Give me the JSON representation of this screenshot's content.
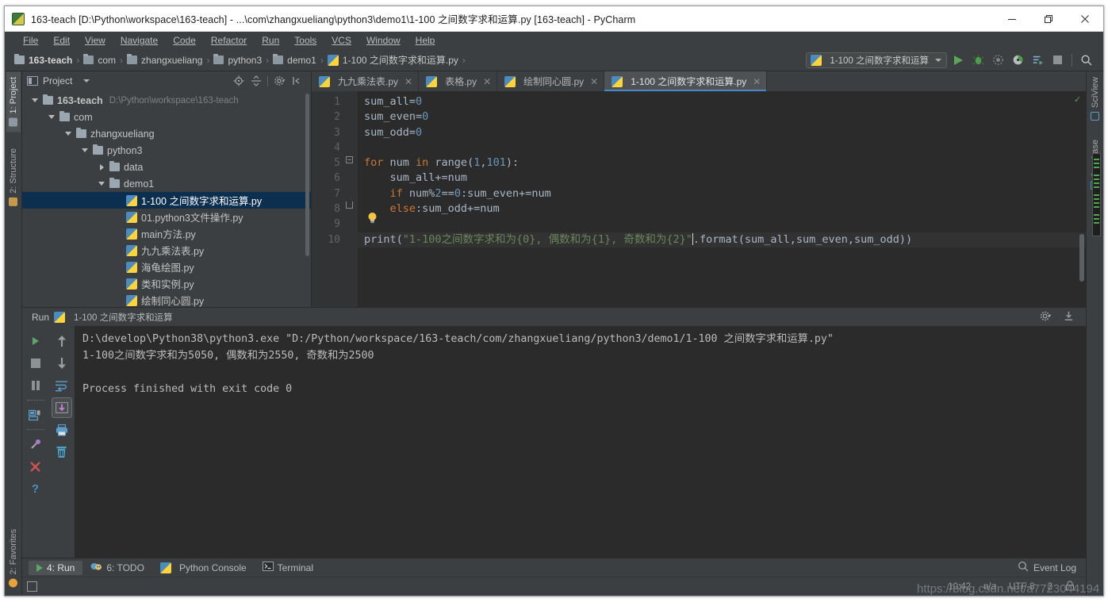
{
  "window": {
    "title": "163-teach [D:\\Python\\workspace\\163-teach] - ...\\com\\zhangxueliang\\python3\\demo1\\1-100 之间数字求和运算.py [163-teach] - PyCharm",
    "icon": "pycharm-icon",
    "minimize": "—",
    "maximize": "❐",
    "close": "✕"
  },
  "menubar": [
    {
      "label": "File"
    },
    {
      "label": "Edit"
    },
    {
      "label": "View"
    },
    {
      "label": "Navigate"
    },
    {
      "label": "Code"
    },
    {
      "label": "Refactor"
    },
    {
      "label": "Run"
    },
    {
      "label": "Tools"
    },
    {
      "label": "VCS"
    },
    {
      "label": "Window"
    },
    {
      "label": "Help"
    }
  ],
  "breadcrumb": [
    {
      "label": "163-teach",
      "icon": "folder-icon"
    },
    {
      "label": "com",
      "icon": "folder-icon"
    },
    {
      "label": "zhangxueliang",
      "icon": "folder-icon"
    },
    {
      "label": "python3",
      "icon": "folder-icon"
    },
    {
      "label": "demo1",
      "icon": "folder-icon"
    },
    {
      "label": "1-100 之间数字求和运算.py",
      "icon": "python-file-icon"
    }
  ],
  "toolbar": {
    "run_config": "1-100 之间数字求和运算",
    "buttons": [
      "run-button",
      "debug-button",
      "coverage-button",
      "profile-button",
      "rerun-button",
      "stop-button",
      "search-everywhere-button"
    ]
  },
  "left_strip": [
    {
      "label": "1: Project",
      "active": true
    },
    {
      "label": "2: Structure",
      "active": false
    },
    {
      "label": "2: Favorites",
      "active": false
    }
  ],
  "right_strip": [
    {
      "label": "SciView"
    },
    {
      "label": "Database"
    }
  ],
  "project": {
    "title": "Project",
    "tree": [
      {
        "indent": 0,
        "arrow": "down",
        "icon": "folder-icon",
        "label": "163-teach",
        "path": "D:\\Python\\workspace\\163-teach",
        "bold": true,
        "selected": false
      },
      {
        "indent": 1,
        "arrow": "down",
        "icon": "folder-icon",
        "label": "com",
        "path": "",
        "bold": false,
        "selected": false
      },
      {
        "indent": 2,
        "arrow": "down",
        "icon": "folder-icon",
        "label": "zhangxueliang",
        "path": "",
        "bold": false,
        "selected": false
      },
      {
        "indent": 3,
        "arrow": "down",
        "icon": "folder-icon",
        "label": "python3",
        "path": "",
        "bold": false,
        "selected": false
      },
      {
        "indent": 4,
        "arrow": "right",
        "icon": "folder-icon",
        "label": "data",
        "path": "",
        "bold": false,
        "selected": false
      },
      {
        "indent": 4,
        "arrow": "down",
        "icon": "folder-icon",
        "label": "demo1",
        "path": "",
        "bold": false,
        "selected": false
      },
      {
        "indent": 5,
        "arrow": "none",
        "icon": "python-file-icon",
        "label": "1-100 之间数字求和运算.py",
        "path": "",
        "bold": false,
        "selected": true
      },
      {
        "indent": 5,
        "arrow": "none",
        "icon": "python-file-icon",
        "label": "01.python3文件操作.py",
        "path": "",
        "bold": false,
        "selected": false
      },
      {
        "indent": 5,
        "arrow": "none",
        "icon": "python-file-icon",
        "label": "main方法.py",
        "path": "",
        "bold": false,
        "selected": false
      },
      {
        "indent": 5,
        "arrow": "none",
        "icon": "python-file-icon",
        "label": "九九乘法表.py",
        "path": "",
        "bold": false,
        "selected": false
      },
      {
        "indent": 5,
        "arrow": "none",
        "icon": "python-file-icon",
        "label": "海龟绘图.py",
        "path": "",
        "bold": false,
        "selected": false
      },
      {
        "indent": 5,
        "arrow": "none",
        "icon": "python-file-icon",
        "label": "类和实例.py",
        "path": "",
        "bold": false,
        "selected": false
      },
      {
        "indent": 5,
        "arrow": "none",
        "icon": "python-file-icon",
        "label": "绘制同心圆.py",
        "path": "",
        "bold": false,
        "selected": false
      }
    ]
  },
  "editor": {
    "tabs": [
      {
        "label": "九九乘法表.py",
        "active": false
      },
      {
        "label": "表格.py",
        "active": false
      },
      {
        "label": "绘制同心圆.py",
        "active": false
      },
      {
        "label": "1-100 之间数字求和运算.py",
        "active": true
      }
    ],
    "line_numbers": [
      "1",
      "2",
      "3",
      "4",
      "5",
      "6",
      "7",
      "8",
      "9",
      "10"
    ],
    "code": {
      "l1_var": "sum_all",
      "l1_eq": "=",
      "l1_num": "0",
      "l2_var": "sum_even",
      "l2_num": "0",
      "l3_var": "sum_odd",
      "l3_num": "0",
      "l5_kw_for": "for",
      "l5_var": " num ",
      "l5_kw_in": "in",
      "l5_fn": " range(",
      "l5_a": "1",
      "l5_comma": ",",
      "l5_b": "101",
      "l5_end": "):",
      "l6": "    sum_all+=num",
      "l7_pre": "    ",
      "l7_kw": "if",
      "l7_mid": " num%",
      "l7_n2": "2",
      "l7_eq": "==",
      "l7_n0": "0",
      "l7_rest": ":sum_even+=num",
      "l8_pre": "    ",
      "l8_kw": "else",
      "l8_rest": ":sum_odd+=num",
      "l10_fn": "print",
      "l10_open": "(",
      "l10_str": "\"1-100之间数字求和为{0}, 偶数和为{1}, 奇数和为{2}\"",
      "l10_tail": ".format(sum_all,sum_even,sum_odd))"
    }
  },
  "run_panel": {
    "title": "Run",
    "config_name": "1-100 之间数字求和运算",
    "output": [
      "D:\\develop\\Python38\\python3.exe \"D:/Python/workspace/163-teach/com/zhangxueliang/python3/demo1/1-100 之间数字求和运算.py\"",
      "1-100之间数字求和为5050, 偶数和为2550, 奇数和为2500",
      "",
      "Process finished with exit code 0"
    ],
    "left_tools": [
      "rerun-icon",
      "stop-icon",
      "pause-icon",
      "print-settings-icon",
      "pin-icon",
      "close-icon",
      "help-icon"
    ],
    "right_tools": [
      "scroll-up-icon",
      "scroll-down-icon",
      "soft-wrap-icon",
      "scroll-to-end-icon",
      "print-icon",
      "trash-icon"
    ],
    "header_tools": [
      "settings-icon",
      "hide-icon"
    ]
  },
  "statusbar": {
    "tabs": [
      {
        "label": "4: Run",
        "icon": "run-icon",
        "active": true
      },
      {
        "label": "6: TODO",
        "icon": "todo-icon",
        "active": false
      },
      {
        "label": "Python Console",
        "icon": "python-icon",
        "active": false
      },
      {
        "label": "Terminal",
        "icon": "terminal-icon",
        "active": false
      }
    ],
    "event_log": "Event Log",
    "time": "10:42",
    "line_col": "n/a",
    "encoding": "UTF-8",
    "indent": "2",
    "lock": "lock-icon"
  },
  "watermark": "https://blog.csdn.net/a7723044194"
}
